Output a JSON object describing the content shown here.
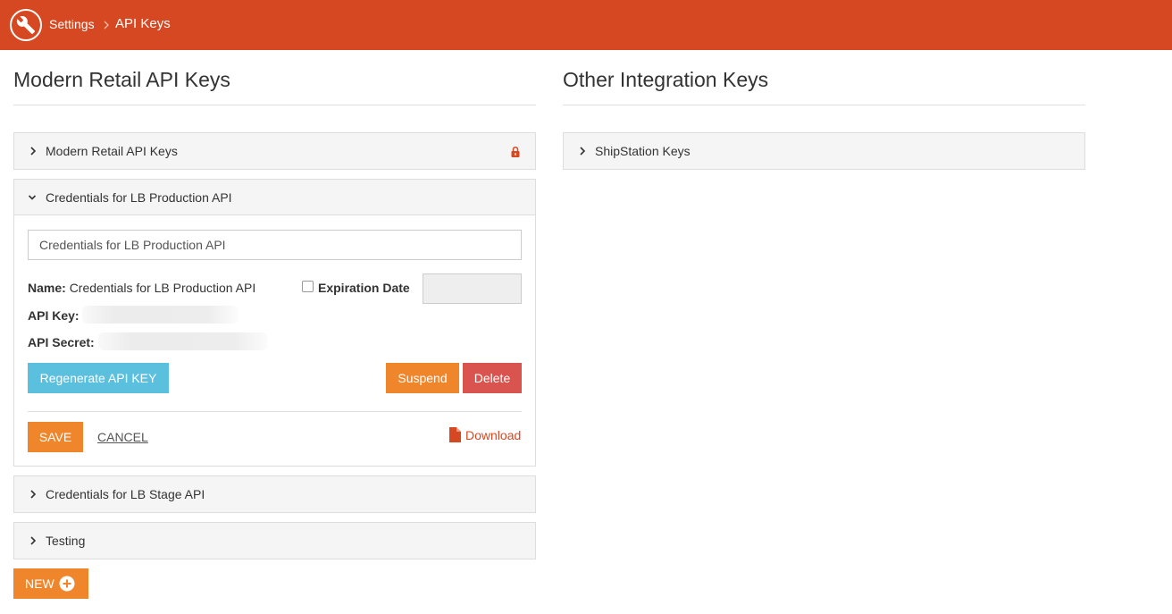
{
  "header": {
    "breadcrumb": [
      "Settings",
      "API Keys"
    ],
    "logo_icon": "wrench-icon",
    "brand_color": "#d64821"
  },
  "left": {
    "title": "Modern Retail API Keys",
    "panels": [
      {
        "title": "Modern Retail API Keys",
        "state": "collapsed",
        "locked": true
      },
      {
        "title": "Credentials for LB Production API",
        "state": "expanded"
      },
      {
        "title": "Credentials for LB Stage API",
        "state": "collapsed"
      },
      {
        "title": "Testing",
        "state": "collapsed"
      }
    ],
    "detail": {
      "name_input_value": "Credentials for LB Production API",
      "name_label": "Name:",
      "name_value": "Credentials for LB Production API",
      "expiration_label": "Expiration Date",
      "expiration_checked": false,
      "api_key_label": "API Key:",
      "api_secret_label": "API Secret:",
      "regenerate_label": "Regenerate API KEY",
      "suspend_label": "Suspend",
      "delete_label": "Delete",
      "save_label": "SAVE",
      "cancel_label": "CANCEL",
      "download_label": "Download"
    },
    "new_label": "NEW"
  },
  "right": {
    "title": "Other Integration Keys",
    "panels": [
      {
        "title": "ShipStation Keys",
        "state": "collapsed"
      }
    ]
  },
  "colors": {
    "orange": "#f0862b",
    "info_blue": "#5bc0de",
    "danger_red": "#d9534f",
    "link_red": "#d64821"
  }
}
